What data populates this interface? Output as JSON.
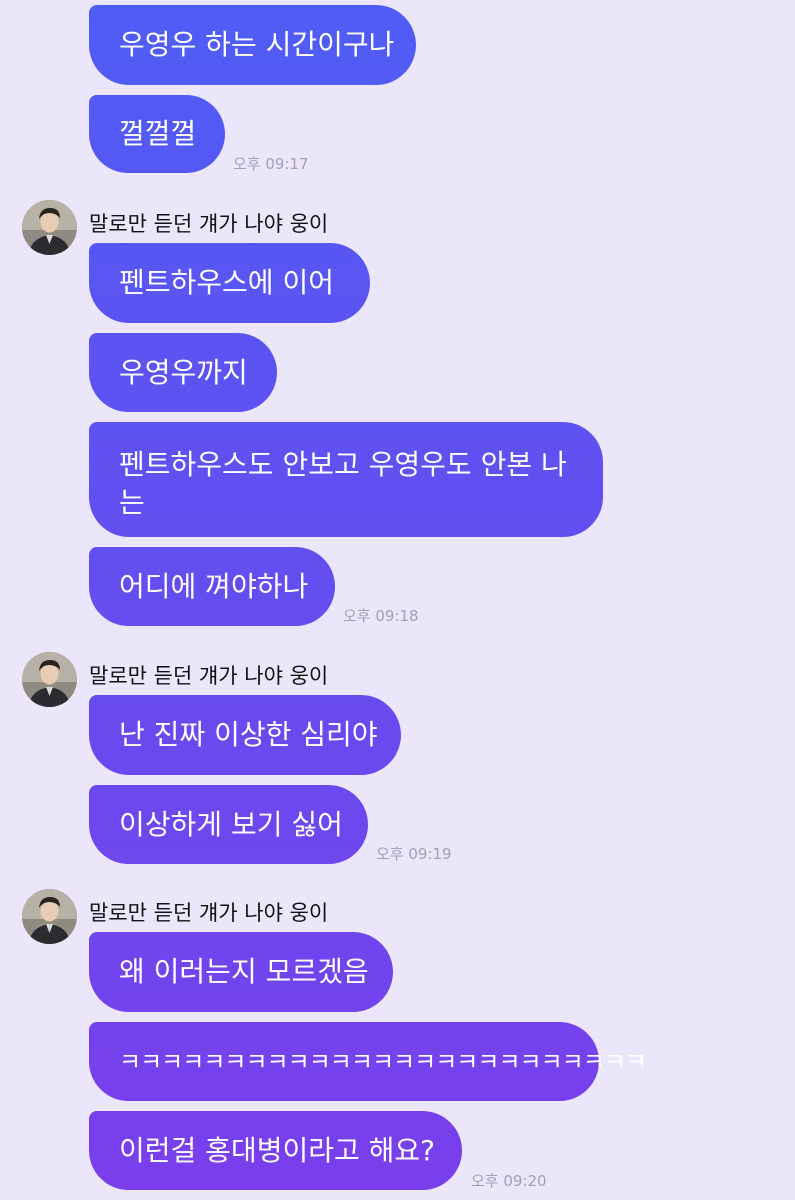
{
  "theme": {
    "background": "#ece6fb",
    "bubble_gradient_top": "#4f5df5",
    "bubble_gradient_bottom": "#7a3eeb",
    "timestamp_color": "#a59fb5"
  },
  "groups": [
    {
      "messages": [
        {
          "text": "우영우 하는 시간이구나"
        },
        {
          "text": "껄껄껄"
        }
      ],
      "time": "오후 09:17"
    },
    {
      "sender": {
        "name": "말로만 듣던 걔가 나야 웅이",
        "avatar_icon": "profile-photo-avatar"
      },
      "messages": [
        {
          "text": "펜트하우스에 이어"
        },
        {
          "text": "우영우까지"
        },
        {
          "text": "펜트하우스도 안보고 우영우도 안본 나는"
        },
        {
          "text": "어디에 껴야하나"
        }
      ],
      "time": "오후 09:18"
    },
    {
      "sender": {
        "name": "말로만 듣던 걔가 나야 웅이",
        "avatar_icon": "profile-photo-avatar"
      },
      "messages": [
        {
          "text": "난 진짜 이상한 심리야"
        },
        {
          "text": "이상하게 보기 싫어"
        }
      ],
      "time": "오후 09:19"
    },
    {
      "sender": {
        "name": "말로만 듣던 걔가 나야 웅이",
        "avatar_icon": "profile-photo-avatar"
      },
      "messages": [
        {
          "text": "왜 이러는지 모르겠음"
        },
        {
          "text": "ㅋㅋㅋㅋㅋㅋㅋㅋㅋㅋㅋㅋㅋㅋㅋㅋㅋㅋㅋㅋㅋㅋㅋㅋㅋ"
        },
        {
          "text": "이런걸 홍대병이라고 해요?"
        }
      ],
      "time": "오후 09:20"
    }
  ]
}
